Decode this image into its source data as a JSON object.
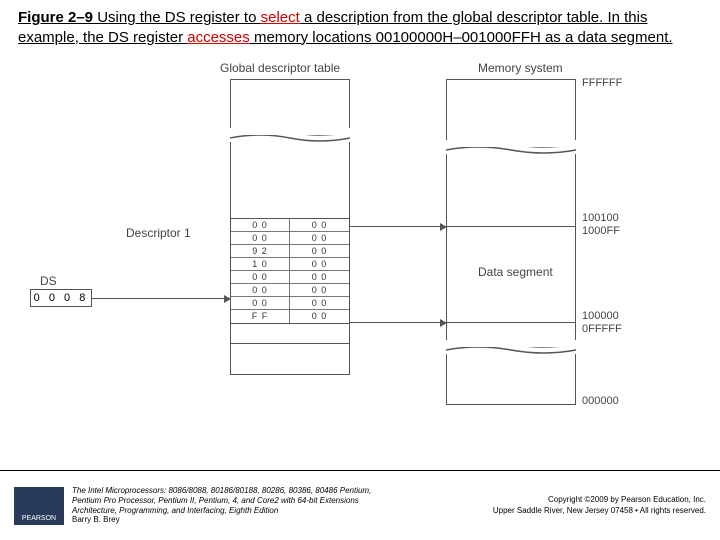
{
  "caption": {
    "fignum": "Figure 2–9",
    "pre": "  Using the DS register to ",
    "w1": "select",
    "mid1": " a description from the global descriptor table. In this example, the DS register ",
    "w2": "accesses",
    "mid2": " memory locations 00100000H–001000FFH as a data segment."
  },
  "labels": {
    "gdt": "Global descriptor table",
    "mem": "Memory system",
    "desc1": "Descriptor 1",
    "ds": "DS",
    "dataseg": "Data segment",
    "top_addr": "FFFFFF",
    "mid_upper_a": "100100",
    "mid_upper_b": "1000FF",
    "mid_lower_a": "100000",
    "mid_lower_b": "0FFFFF",
    "bot_addr": "000000"
  },
  "ds_value": "0 0 0 8",
  "descriptor_bytes": [
    [
      "0 0",
      "0 0"
    ],
    [
      "0 0",
      "0 0"
    ],
    [
      "9 2",
      "0 0"
    ],
    [
      "1 0",
      "0 0"
    ],
    [
      "0 0",
      "0 0"
    ],
    [
      "0 0",
      "0 0"
    ],
    [
      "0 0",
      "0 0"
    ],
    [
      "F F",
      "0 0"
    ]
  ],
  "footer": {
    "logo": "PEARSON",
    "book1": "The Intel Microprocessors: 8086/8088, 80186/80188, 80286, 80386, 80486 Pentium,",
    "book2": "Pentium Pro Processor, Pentium II, Pentium, 4, and Core2 with 64-bit Extensions",
    "book3": "Architecture, Programming, and Interfacing, Eighth Edition",
    "author": "Barry B. Brey",
    "copy1": "Copyright ©2009 by Pearson Education, Inc.",
    "copy2": "Upper Saddle River, New Jersey 07458 • All rights reserved."
  }
}
